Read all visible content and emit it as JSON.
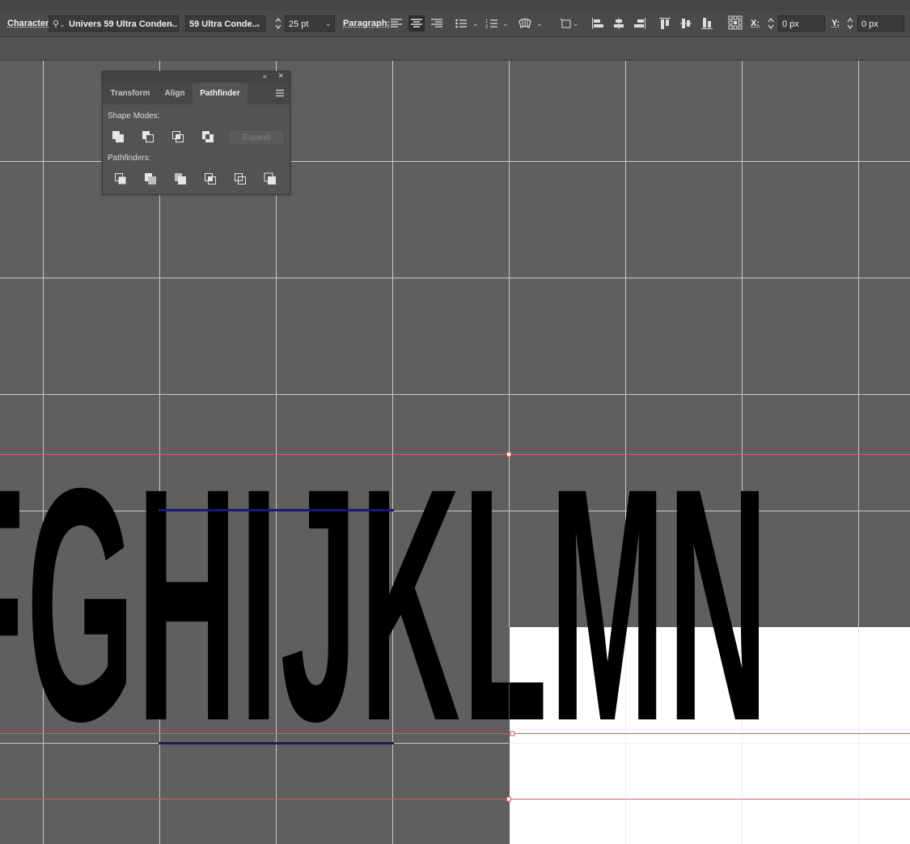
{
  "control_bar": {
    "character_label": "Character:",
    "font_family": "Univers 59 Ultra Conden...",
    "font_style": "59 Ultra Conde...",
    "font_size": "25 pt",
    "paragraph_label": "Paragraph:",
    "x_label": "X:",
    "x_value": "0 px",
    "y_label": "Y:",
    "y_value": "0 px"
  },
  "pathfinder_panel": {
    "tabs": [
      "Transform",
      "Align",
      "Pathfinder"
    ],
    "active_tab": "Pathfinder",
    "shape_modes_label": "Shape Modes:",
    "expand_label": "Expand",
    "pathfinders_label": "Pathfinders:"
  },
  "canvas": {
    "text": "FGHIJKLMN",
    "artboard_color": "#ffffff",
    "text_color": "#000000",
    "guide_color": "#e06060",
    "selection_line_color": "#1c1c7a",
    "grid_color": "#d8d8d8"
  },
  "icons": [
    "search-icon",
    "align-left-icon",
    "align-center-icon",
    "align-right-icon",
    "bullets-icon",
    "numbering-icon",
    "warp-icon",
    "transform-icon",
    "align-objects-icons",
    "reference-point-icon"
  ]
}
